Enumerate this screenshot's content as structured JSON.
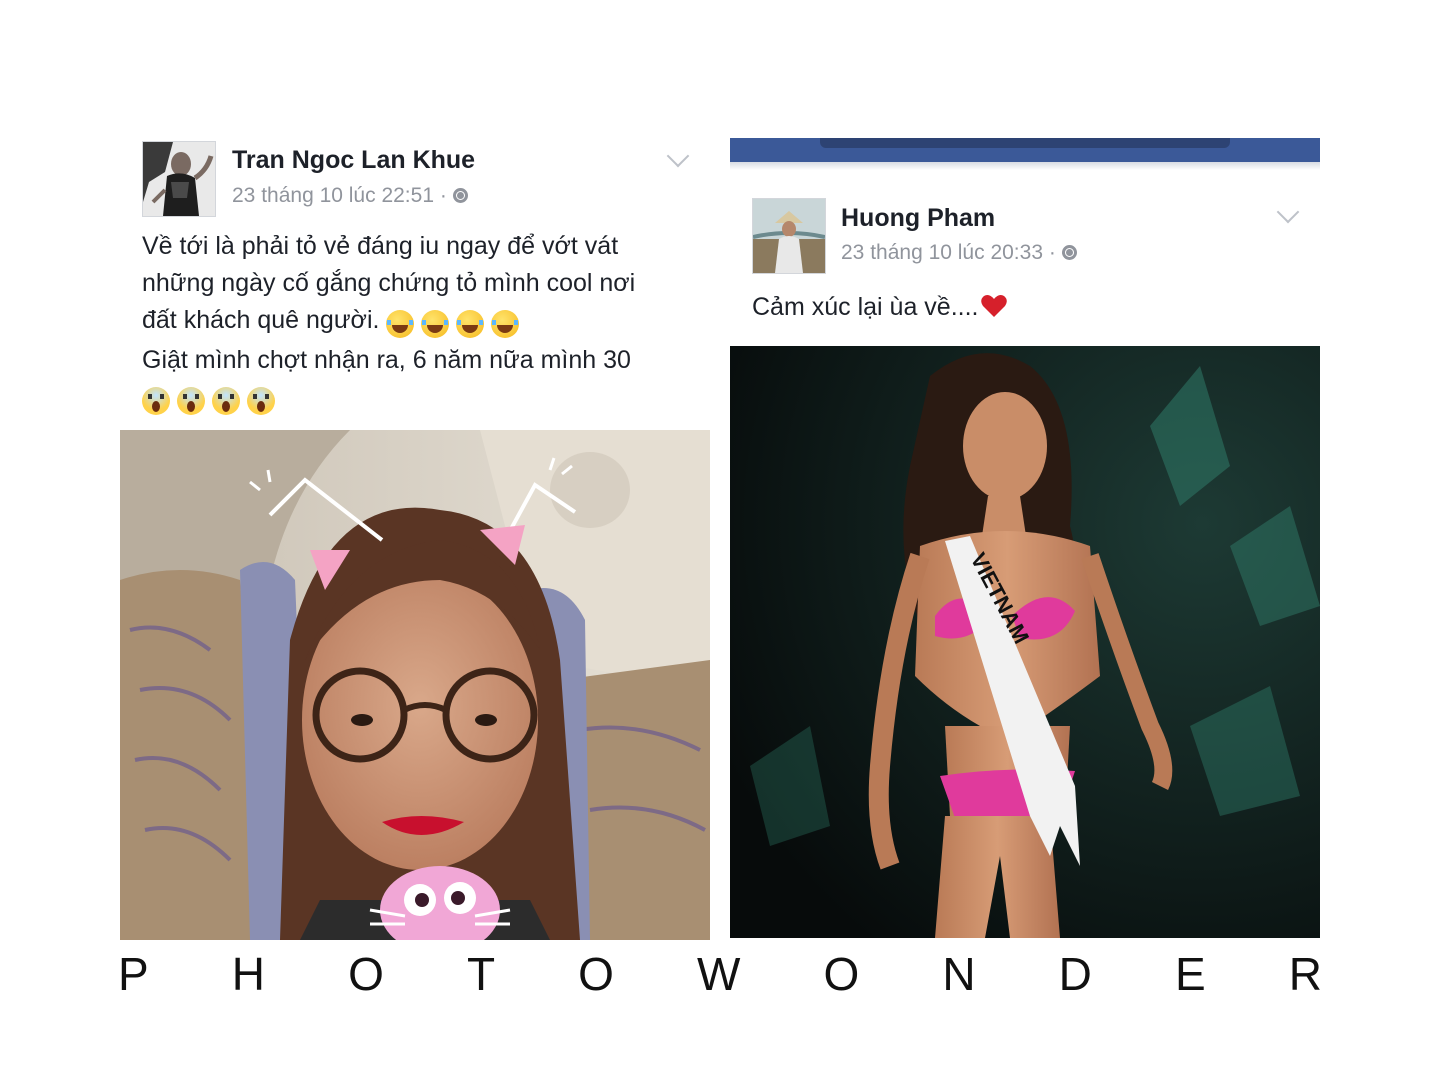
{
  "posts": [
    {
      "author": "Tran Ngoc Lan Khue",
      "timestamp": "23 tháng 10 lúc 22:51 ·",
      "privacy_icon": "globe-icon",
      "text_lines": [
        "Về tới là phải tỏ vẻ đáng iu ngay để vớt vát",
        "những ngày cố gắng chứng tỏ mình cool nơi",
        "đất khách quê người.",
        "Giật mình chợt nhận ra, 6 năm nữa mình 30"
      ],
      "emoji_line3": "face-with-tears-of-joy x4",
      "emoji_line5": "face-screaming-in-fear x4",
      "menu_icon": "chevron-down-icon"
    },
    {
      "author": "Huong Pham",
      "timestamp": "23 tháng 10 lúc 20:33 ·",
      "privacy_icon": "globe-icon",
      "text": "Cảm xúc lại ùa về....",
      "text_icon": "heart-icon",
      "menu_icon": "chevron-down-icon",
      "sash_text": "VIETNAM"
    }
  ],
  "watermark": [
    "P",
    "H",
    "O",
    "T",
    "O",
    "W",
    "O",
    "N",
    "D",
    "E",
    "R"
  ],
  "colors": {
    "facebook_blue": "#3b5998",
    "text": "#1d2129",
    "meta_gray": "#90949c",
    "bikini_pink": "#e03a9c",
    "lipstick_red": "#c8102e"
  }
}
